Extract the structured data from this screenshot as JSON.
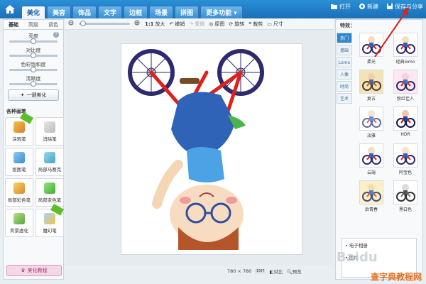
{
  "app": {
    "tabs": [
      "美化",
      "美容",
      "饰品",
      "文字",
      "边框",
      "场景",
      "拼图",
      "更多功能 ▾"
    ],
    "right_actions": {
      "open": "打开",
      "new": "新建",
      "save_share": "保存与分享"
    }
  },
  "toolbar": {
    "ratio": "1:1",
    "enlarge": "放大",
    "undo": "撤销",
    "redo": "重做",
    "original": "原图",
    "rotate": "旋转",
    "crop": "裁剪",
    "size": "尺寸"
  },
  "left_panel": {
    "tabs": [
      "基础",
      "高级",
      "调色"
    ],
    "sliders": [
      {
        "label": "亮度",
        "value": 0.5
      },
      {
        "label": "对比度",
        "value": 0.5
      },
      {
        "label": "色彩饱和度",
        "value": 0.5
      },
      {
        "label": "清晰度",
        "value": 0.5
      }
    ],
    "one_click": "一键美化",
    "brushes_title": "各种画笔",
    "tools": [
      "涂鸦笔",
      "消除笔",
      "抠图笔",
      "局部马赛克",
      "局部彩色笔",
      "局部变色笔",
      "背景虚化",
      "魔幻笔"
    ],
    "tutorial": "美化教程"
  },
  "right_panel": {
    "title": "特效：",
    "categories": [
      "热门",
      "基础",
      "Lomo",
      "人像",
      "时尚",
      "艺术"
    ],
    "effects": [
      "柔光",
      "经典lomo",
      "复古",
      "粉红佳人",
      "淡雅",
      "HDR",
      "云端",
      "阿宝色",
      "后青春",
      "黑白色"
    ],
    "list": [
      "电子相册",
      "图片"
    ]
  },
  "bottom": {
    "size": "780 × 780",
    "compare": "对比",
    "preview": "预览"
  },
  "watermark": "查字典教程网",
  "colors": {
    "accent": "#1a6fb8",
    "arrow": "#e0201a"
  }
}
